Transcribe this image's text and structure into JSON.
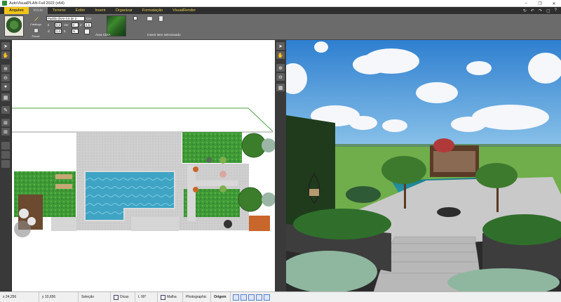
{
  "window": {
    "title": "AutoVisualPLAN Full 2022 (x64)",
    "controls": [
      "–",
      "❐",
      "✕"
    ]
  },
  "ribbon": {
    "tabs": [
      "Arquivo",
      "Início",
      "Terreno",
      "Exibir",
      "Inserir",
      "Organizar",
      "Formatação",
      "VisualRender"
    ],
    "active_tab": "Início",
    "right_icons": [
      "↻",
      "↶",
      "↷",
      "▢",
      "?"
    ],
    "labels": {
      "catalog": "Catálogo",
      "thumb_label": "Área CDIA",
      "brush": "Pincel",
      "insert_hint": "Inserir item selecionado",
      "field_paint_label": "Padrão (livre 0,5 de 2",
      "field_cm": "Cm",
      "field_1_label": "ti",
      "field_1_val": "0,5",
      "field_2_label": "Ver",
      "field_2_val": "0",
      "field_3_label": "d",
      "field_3_val": "2,5",
      "field_4_label": "d",
      "field_4_val": "2,5",
      "field_5_label": "5",
      "field_5_val": "N"
    }
  },
  "left_toolbar": [
    "arrow",
    "hand",
    "zoom-in",
    "zoom-out",
    "zoom-fit",
    "measure",
    "pencil",
    "grid",
    "grid2",
    "layer",
    "layer2",
    "layer3"
  ],
  "status_bar": {
    "x": "x 24,256",
    "y": "y 10,656",
    "mode": "Seleção",
    "tips": "Dicas",
    "angle": "L 90°",
    "grid": "Malha",
    "render": "Photographic",
    "origin": "Origem"
  },
  "colors": {
    "ribbon_bg": "#6b6b6b",
    "tab_text": "#e4cc4c",
    "file_tab": "#f0c419",
    "grass": "#3f9a36",
    "pool": "#3fa4c4",
    "paving": "#c9c9c9",
    "sky": "#3b8fd8"
  }
}
